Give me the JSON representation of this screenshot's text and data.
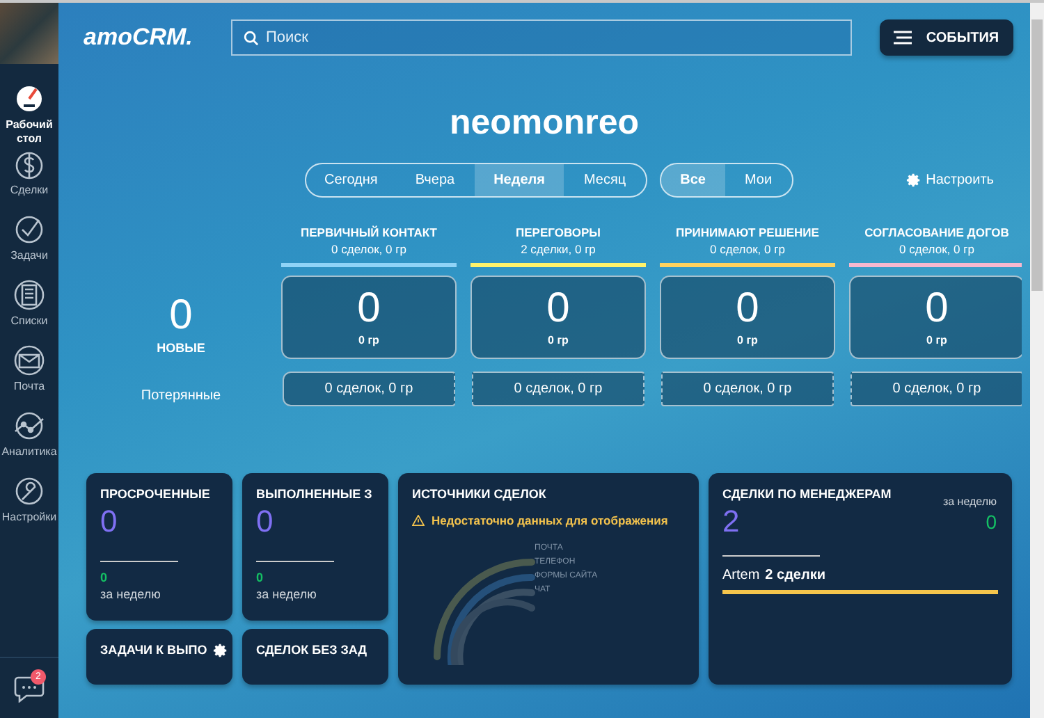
{
  "sidebar": {
    "items": [
      {
        "label": "Рабочий стол",
        "kind": "dashboard",
        "selected": true
      },
      {
        "label": "Сделки",
        "kind": "deals",
        "selected": false
      },
      {
        "label": "Задачи",
        "kind": "tasks",
        "selected": false
      },
      {
        "label": "Списки",
        "kind": "lists",
        "selected": false
      },
      {
        "label": "Почта",
        "kind": "mail",
        "selected": false
      },
      {
        "label": "Аналитика",
        "kind": "analytics",
        "selected": false
      },
      {
        "label": "Настройки",
        "kind": "settings",
        "selected": false
      }
    ],
    "chat_badge": "2"
  },
  "header": {
    "logo": "amoCRM.",
    "search": {
      "placeholder": "Поиск"
    },
    "events_button": "СОБЫТИЯ"
  },
  "title": "neomonreo",
  "period_tabs": [
    {
      "label": "Сегодня",
      "selected": false
    },
    {
      "label": "Вчера",
      "selected": false
    },
    {
      "label": "Неделя",
      "selected": true
    },
    {
      "label": "Месяц",
      "selected": false
    }
  ],
  "owner_tabs": [
    {
      "label": "Все",
      "selected": true
    },
    {
      "label": "Мои",
      "selected": false
    }
  ],
  "configure_button": "Настроить",
  "pipeline": {
    "new": {
      "count": "0",
      "label": "НОВЫЕ"
    },
    "lost_label": "Потерянные",
    "stages": [
      {
        "name": "ПЕРВИЧНЫЙ КОНТАКТ",
        "summary": "0 сделок, 0 гр",
        "color": "#8fd3f7",
        "count": "0",
        "amount": "0 гр",
        "lost": "0 сделок, 0 гр"
      },
      {
        "name": "ПЕРЕГОВОРЫ",
        "summary": "2 сделки, 0 гр",
        "color": "#fff36b",
        "count": "0",
        "amount": "0 гр",
        "lost": "0 сделок, 0 гр"
      },
      {
        "name": "ПРИНИМАЮТ РЕШЕНИЕ",
        "summary": "0 сделок, 0 гр",
        "color": "#ffd25e",
        "count": "0",
        "amount": "0 гр",
        "lost": "0 сделок, 0 гр"
      },
      {
        "name": "СОГЛАСОВАНИЕ ДОГОВ",
        "summary": "0 сделок, 0 гр",
        "color": "#f7b8cf",
        "count": "0",
        "amount": "0 гр",
        "lost": "0 сделок, 0 гр"
      }
    ]
  },
  "widgets": {
    "small": [
      {
        "title": "ПРОСРОЧЕННЫЕ",
        "value": "0",
        "week_value": "0",
        "week_label": "за неделю"
      },
      {
        "title": "ВЫПОЛНЕННЫЕ З",
        "value": "0",
        "week_value": "0",
        "week_label": "за неделю"
      }
    ],
    "small_row2": [
      {
        "title": "ЗАДАЧИ К ВЫПО",
        "has_settings": true
      },
      {
        "title": "СДЕЛОК БЕЗ ЗАД",
        "has_settings": false
      }
    ],
    "sources": {
      "title": "ИСТОЧНИКИ СДЕЛОК",
      "warning": "Недостаточно данных для отображения",
      "legend": [
        "ПОЧТА",
        "ТЕЛЕФОН",
        "ФОРМЫ САЙТА",
        "ЧАТ"
      ]
    },
    "managers": {
      "title": "СДЕЛКИ ПО МЕНЕДЖЕРАМ",
      "value": "2",
      "week_label": "за неделю",
      "week_value": "0",
      "rows": [
        {
          "name": "Artem",
          "deals": "2 сделки",
          "level": 1
        }
      ]
    }
  }
}
